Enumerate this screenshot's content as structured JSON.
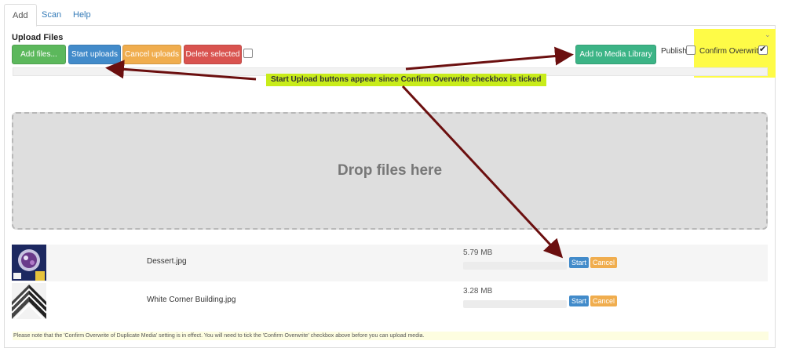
{
  "tabs": [
    {
      "label": "Add"
    },
    {
      "label": "Scan"
    },
    {
      "label": "Help"
    }
  ],
  "upload": {
    "title": "Upload Files",
    "buttons": {
      "add_files": "Add files...",
      "start_uploads": "Start uploads",
      "cancel_uploads": "Cancel uploads",
      "delete_selected": "Delete selected",
      "add_to_media_library": "Add to Media Library"
    },
    "publish_label": "Publish",
    "publish_checked": false,
    "confirm_overwrite_label": "Confirm Overwrite",
    "confirm_overwrite_checked": true,
    "callout": "Start Upload buttons appear since Confirm Overwrite checkbox is ticked",
    "dropzone_text": "Drop files here",
    "files": [
      {
        "name": "Dessert.jpg",
        "size": "5.79 MB",
        "start": "Start",
        "cancel": "Cancel"
      },
      {
        "name": "White Corner Building.jpg",
        "size": "3.28 MB",
        "start": "Start",
        "cancel": "Cancel"
      }
    ],
    "note": "Please note that the 'Confirm Overwrite of Duplicate Media' setting is in effect. You will need to tick the 'Confirm Overwrite' checkbox above before you can upload media."
  },
  "colors": {
    "green": "#5cb85c",
    "blue": "#428bca",
    "orange": "#f0ad4e",
    "red": "#d9534f",
    "teal": "#3cb486",
    "highlight": "#fefb47",
    "callout": "#c8ec1a",
    "arrow": "#6b0f0f"
  }
}
